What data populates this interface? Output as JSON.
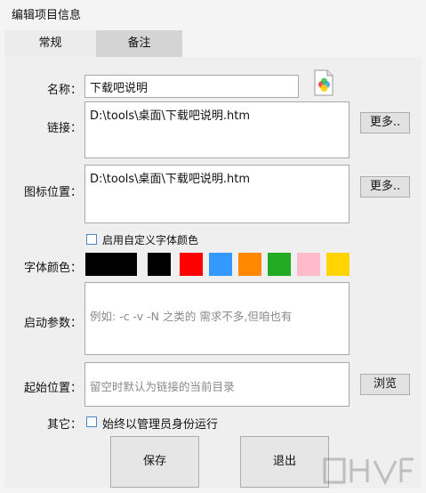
{
  "window": {
    "title": "编辑项目信息"
  },
  "tabs": [
    {
      "label": "常规"
    },
    {
      "label": "备注"
    }
  ],
  "form": {
    "name_label": "名称：",
    "name_value": "下载吧说明",
    "link_label": "链接：",
    "link_value": "D:\\tools\\桌面\\下载吧说明.htm",
    "more_label": "更多..",
    "icon_pos_label": "图标位置：",
    "icon_pos_value": "D:\\tools\\桌面\\下载吧说明.htm",
    "custom_font_color_label": "启用自定义字体颜色",
    "font_color_label": "字体颜色：",
    "swatches": [
      "#000000",
      "#000000",
      "#ff0000",
      "#3399ff",
      "#ff8800",
      "#22aa22",
      "#ffbbcc",
      "#ffd400"
    ],
    "params_label": "启动参数：",
    "params_placeholder": "例如:  -c -v -N 之类的 需求不多,但咱也有",
    "start_pos_label": "起始位置：",
    "start_pos_placeholder": "留空时默认为链接的当前目录",
    "browse_label": "浏览",
    "other_label": "其它：",
    "admin_label": "始终以管理员身份运行",
    "save_label": "保存",
    "exit_label": "退出"
  },
  "icons": {
    "file_icon": "file-icon",
    "watermark": "watermark-logo"
  }
}
